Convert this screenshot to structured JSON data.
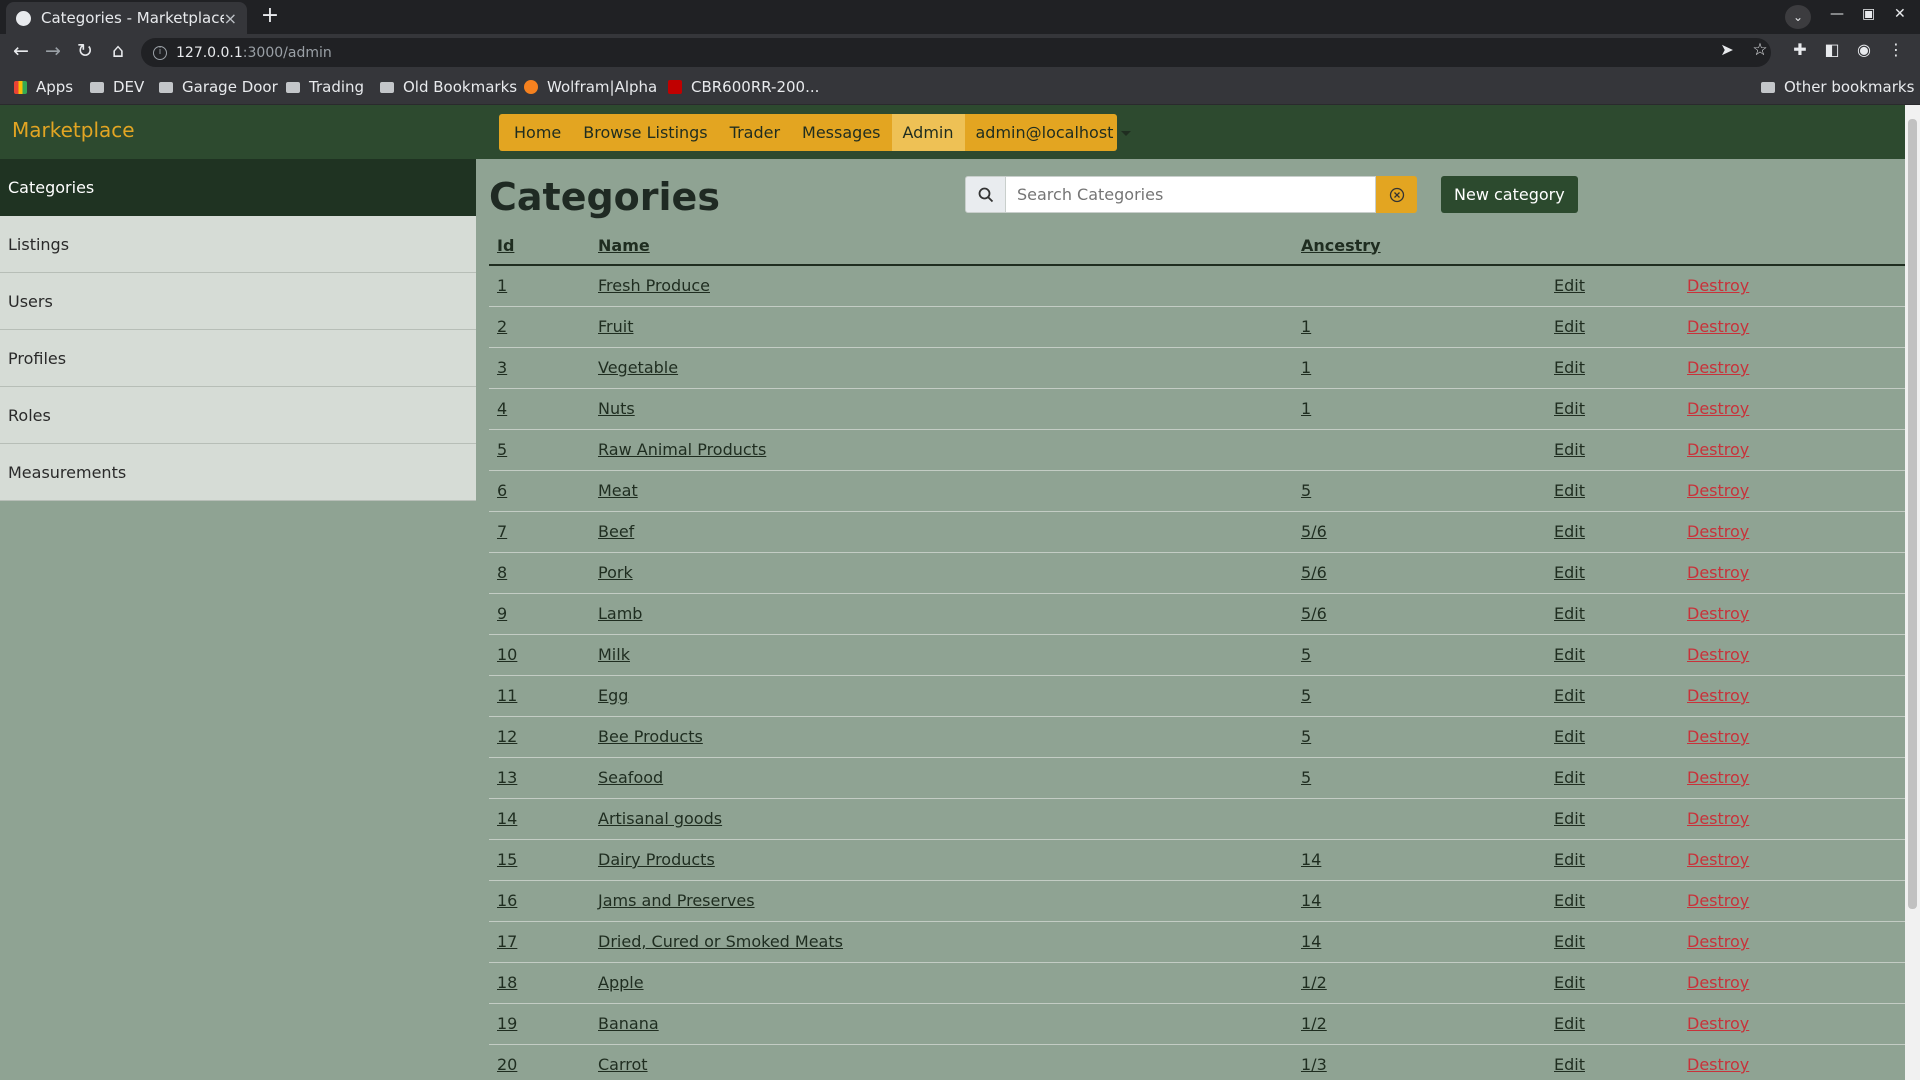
{
  "browser": {
    "tab_title": "Categories - Marketplace",
    "tab_close": "×",
    "new_tab": "+",
    "url_host": "127.0.0.1",
    "url_path": ":3000/admin",
    "bookmarks": [
      "Apps",
      "DEV",
      "Garage Door",
      "Trading",
      "Old Bookmarks",
      "Wolfram|Alpha",
      "CBR600RR-200..."
    ],
    "other_bookmarks": "Other bookmarks"
  },
  "navbar": {
    "brand": "Marketplace",
    "links": [
      "Home",
      "Browse Listings",
      "Trader",
      "Messages",
      "Admin"
    ],
    "active": "Admin",
    "user_menu": "admin@localhost"
  },
  "sidebar": {
    "items": [
      "Categories",
      "Listings",
      "Users",
      "Profiles",
      "Roles",
      "Measurements"
    ],
    "active": "Categories"
  },
  "page": {
    "title": "Categories",
    "search_placeholder": "Search Categories",
    "new_button": "New category"
  },
  "table": {
    "headers": [
      "Id",
      "Name",
      "Ancestry"
    ],
    "edit_label": "Edit",
    "destroy_label": "Destroy",
    "rows": [
      {
        "id": "1",
        "name": "Fresh Produce",
        "ancestry": ""
      },
      {
        "id": "2",
        "name": "Fruit",
        "ancestry": "1"
      },
      {
        "id": "3",
        "name": "Vegetable",
        "ancestry": "1"
      },
      {
        "id": "4",
        "name": "Nuts",
        "ancestry": "1"
      },
      {
        "id": "5",
        "name": "Raw Animal Products",
        "ancestry": ""
      },
      {
        "id": "6",
        "name": "Meat",
        "ancestry": "5"
      },
      {
        "id": "7",
        "name": "Beef",
        "ancestry": "5/6"
      },
      {
        "id": "8",
        "name": "Pork",
        "ancestry": "5/6"
      },
      {
        "id": "9",
        "name": "Lamb",
        "ancestry": "5/6"
      },
      {
        "id": "10",
        "name": "Milk",
        "ancestry": "5"
      },
      {
        "id": "11",
        "name": "Egg",
        "ancestry": "5"
      },
      {
        "id": "12",
        "name": "Bee Products",
        "ancestry": "5"
      },
      {
        "id": "13",
        "name": "Seafood",
        "ancestry": "5"
      },
      {
        "id": "14",
        "name": "Artisanal goods",
        "ancestry": ""
      },
      {
        "id": "15",
        "name": "Dairy Products",
        "ancestry": "14"
      },
      {
        "id": "16",
        "name": "Jams and Preserves",
        "ancestry": "14"
      },
      {
        "id": "17",
        "name": "Dried, Cured or Smoked Meats",
        "ancestry": "14"
      },
      {
        "id": "18",
        "name": "Apple",
        "ancestry": "1/2"
      },
      {
        "id": "19",
        "name": "Banana",
        "ancestry": "1/2"
      },
      {
        "id": "20",
        "name": "Carrot",
        "ancestry": "1/3"
      }
    ]
  },
  "colors": {
    "navbar": "#2d4a2f",
    "accent": "#e3a521",
    "page_bg": "#8fa393",
    "destroy": "#c8323a"
  }
}
